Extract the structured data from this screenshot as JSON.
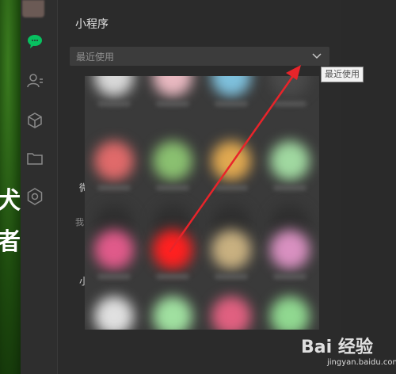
{
  "panel": {
    "title": "小程序",
    "dropdown": {
      "selected": "最近使用"
    },
    "tooltip": "最近使用",
    "side_labels": [
      "微",
      "我",
      "小"
    ]
  },
  "sidebar": {
    "items": [
      {
        "icon": "chat-icon",
        "active": true
      },
      {
        "icon": "contacts-icon",
        "active": false
      },
      {
        "icon": "cube-icon",
        "active": false
      },
      {
        "icon": "folder-icon",
        "active": false
      },
      {
        "icon": "settings-gear-icon",
        "active": false
      }
    ]
  },
  "grid": {
    "rows": [
      [
        "#d8d8d8",
        "#e8b8c0",
        "#7ec0dc",
        "#4a4a4a"
      ],
      [
        "#e06a6a",
        "#8ac070",
        "#e0a850",
        "#a0d8a0"
      ],
      [
        "#2f2f2f",
        "#2f2f2f",
        "#2f2f2f",
        "#2f2f2f"
      ],
      [
        "#e05a8a",
        "#ff2020",
        "#c8b080",
        "#d890c0"
      ],
      [
        "#e0e0e0",
        "#a0e0a0",
        "#e06080",
        "#90d890"
      ]
    ]
  },
  "background": {
    "left_glyphs": [
      "犬",
      "者"
    ]
  },
  "watermark": {
    "brand": "Bai 经验",
    "url": "jingyan.baidu.com"
  },
  "colors": {
    "accent": "#07c160",
    "arrow": "#e8242a"
  }
}
